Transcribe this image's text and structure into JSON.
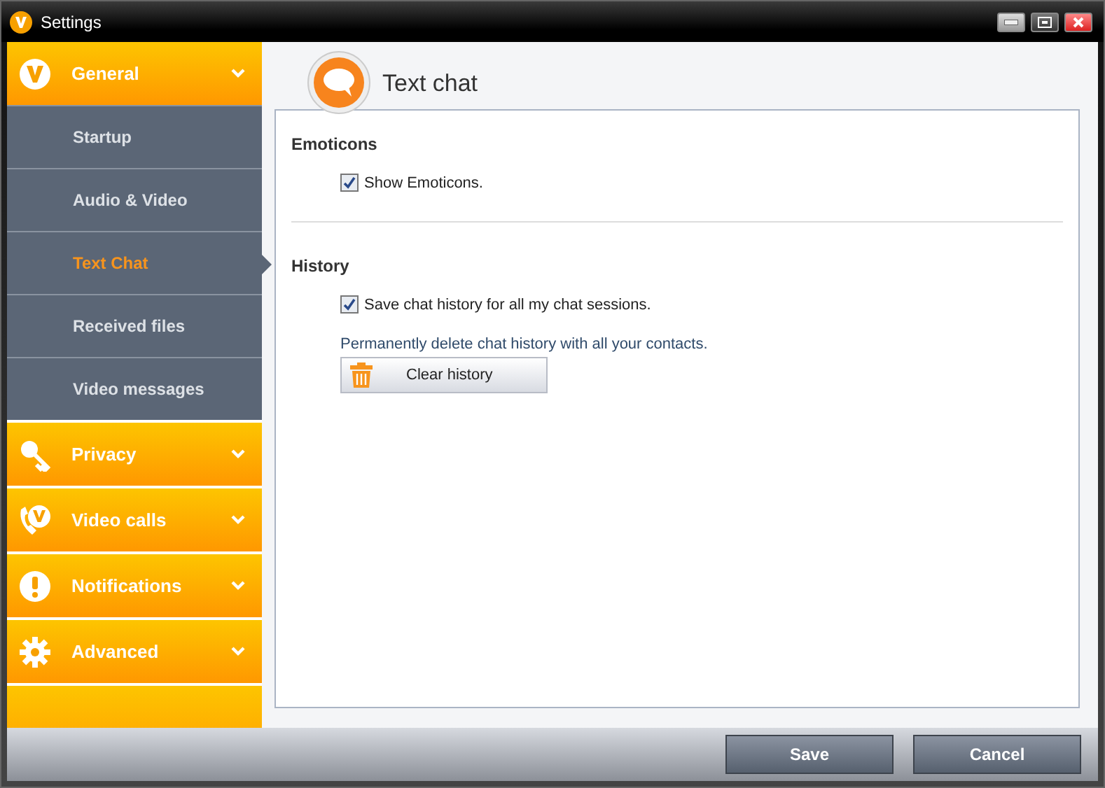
{
  "window": {
    "title": "Settings"
  },
  "sidebar": {
    "sections": [
      {
        "label": "General",
        "children": [
          {
            "label": "Startup",
            "selected": false
          },
          {
            "label": "Audio & Video",
            "selected": false
          },
          {
            "label": "Text Chat",
            "selected": true
          },
          {
            "label": "Received files",
            "selected": false
          },
          {
            "label": "Video messages",
            "selected": false
          }
        ]
      },
      {
        "label": "Privacy"
      },
      {
        "label": "Video calls"
      },
      {
        "label": "Notifications"
      },
      {
        "label": "Advanced"
      }
    ]
  },
  "page": {
    "title": "Text chat",
    "groups": [
      {
        "heading": "Emoticons",
        "items": [
          {
            "kind": "checkbox",
            "label": "Show Emoticons.",
            "checked": true
          }
        ]
      },
      {
        "heading": "History",
        "items": [
          {
            "kind": "checkbox",
            "label": "Save chat history for all my chat sessions.",
            "checked": true
          },
          {
            "kind": "note",
            "label": "Permanently delete chat history with all your contacts."
          },
          {
            "kind": "button",
            "label": "Clear history"
          }
        ]
      }
    ]
  },
  "buttons": [
    "Save",
    "Cancel"
  ]
}
